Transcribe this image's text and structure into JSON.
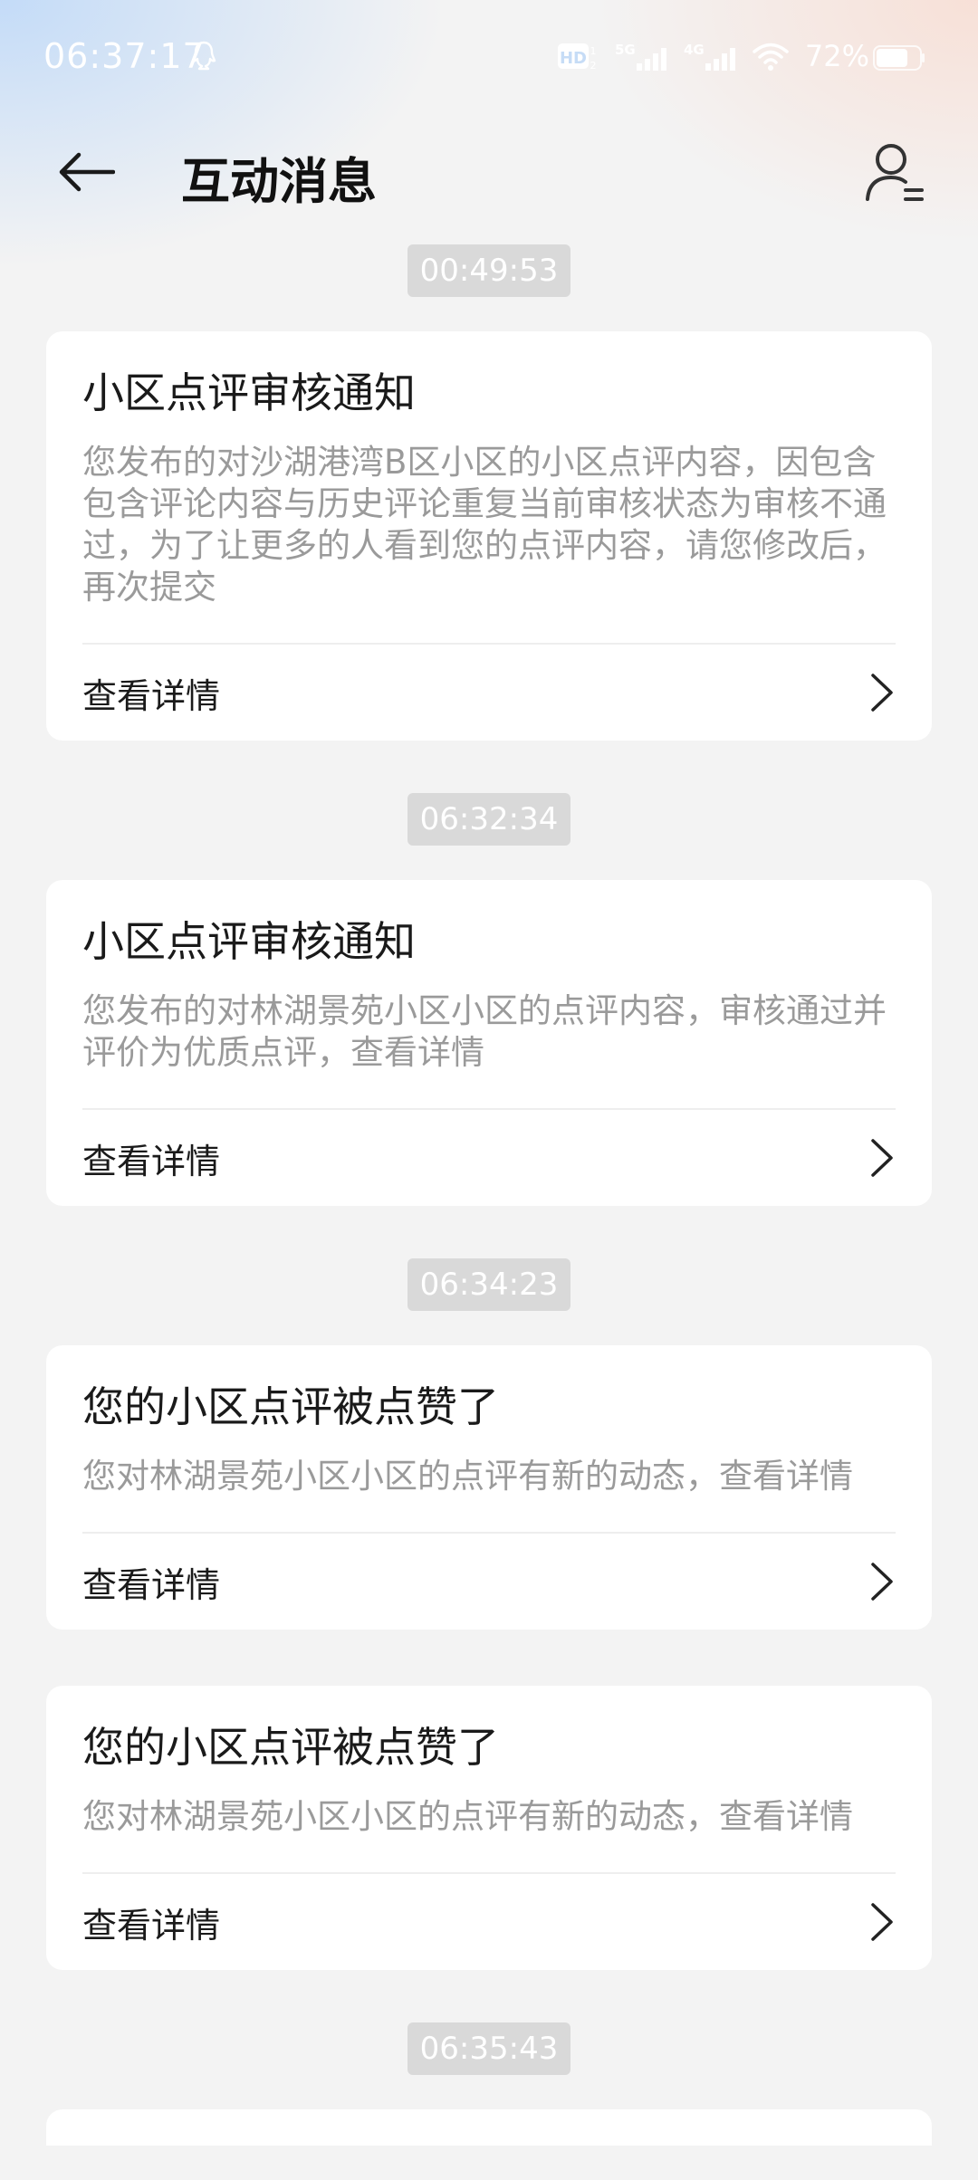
{
  "status_bar": {
    "time": "06:37:17",
    "hd_label": "HD",
    "net1_label": "5G",
    "net2_label": "4G",
    "battery": "72%"
  },
  "nav": {
    "title": "互动消息"
  },
  "messages": [
    {
      "time": "00:49:53",
      "title": "小区点评审核通知",
      "body": "您发布的对沙湖港湾B区小区的小区点评内容，因包含包含评论内容与历史评论重复当前审核状态为审核不通过，为了让更多的人看到您的点评内容，请您修改后，再次提交",
      "link": "查看详情"
    },
    {
      "time": "06:32:34",
      "title": "小区点评审核通知",
      "body": "您发布的对林湖景苑小区小区的点评内容，审核通过并评价为优质点评，查看详情",
      "link": "查看详情"
    },
    {
      "time": "06:34:23",
      "title": "您的小区点评被点赞了",
      "body": "您对林湖景苑小区小区的点评有新的动态，查看详情",
      "link": "查看详情"
    },
    {
      "time": "",
      "title": "您的小区点评被点赞了",
      "body": "您对林湖景苑小区小区的点评有新的动态，查看详情",
      "link": "查看详情"
    },
    {
      "time": "06:35:43"
    }
  ],
  "colors": {
    "background": "#f3f3f3",
    "card": "#ffffff",
    "chip": "#d9d9d9",
    "body_text": "#9a9a9a"
  }
}
